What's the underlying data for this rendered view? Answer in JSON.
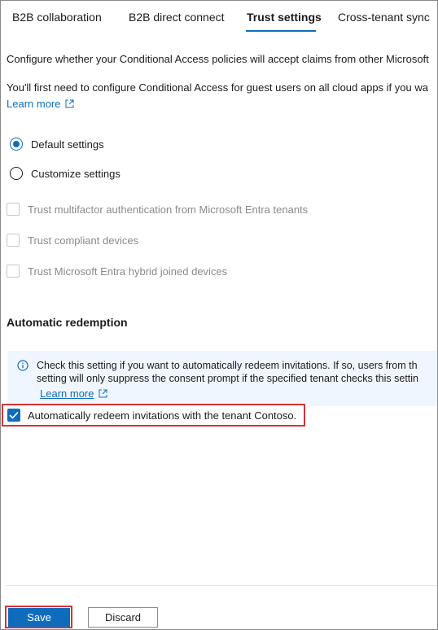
{
  "tabs": [
    {
      "label": "B2B collaboration",
      "active": false
    },
    {
      "label": "B2B direct connect",
      "active": false
    },
    {
      "label": "Trust settings",
      "active": true
    },
    {
      "label": "Cross-tenant sync",
      "active": false
    }
  ],
  "intro": {
    "line1": "Configure whether your Conditional Access policies will accept claims from other Microsoft",
    "line2": "You'll first need to configure Conditional Access for guest users on all cloud apps if you wa",
    "learn_more": "Learn more"
  },
  "trust_options": [
    {
      "label": "Default settings",
      "selected": true
    },
    {
      "label": "Customize settings",
      "selected": false
    }
  ],
  "trust_checkboxes": [
    {
      "label": "Trust multifactor authentication from Microsoft Entra tenants",
      "checked": false,
      "disabled": true
    },
    {
      "label": "Trust compliant devices",
      "checked": false,
      "disabled": true
    },
    {
      "label": "Trust Microsoft Entra hybrid joined devices",
      "checked": false,
      "disabled": true
    }
  ],
  "automatic_redemption": {
    "title": "Automatic redemption",
    "info_line1": "Check this setting if you want to automatically redeem invitations. If so, users from th",
    "info_line2": "setting will only suppress the consent prompt if the specified tenant checks this settin",
    "learn_more": "Learn more",
    "checkbox_label": "Automatically redeem invitations with the tenant Contoso.",
    "checked": true
  },
  "footer": {
    "save_label": "Save",
    "discard_label": "Discard"
  },
  "colors": {
    "accent": "#0f6cbd",
    "highlight": "#d13438",
    "info_bg": "#f0f6ff",
    "disabled_text": "#8a8a8a"
  }
}
